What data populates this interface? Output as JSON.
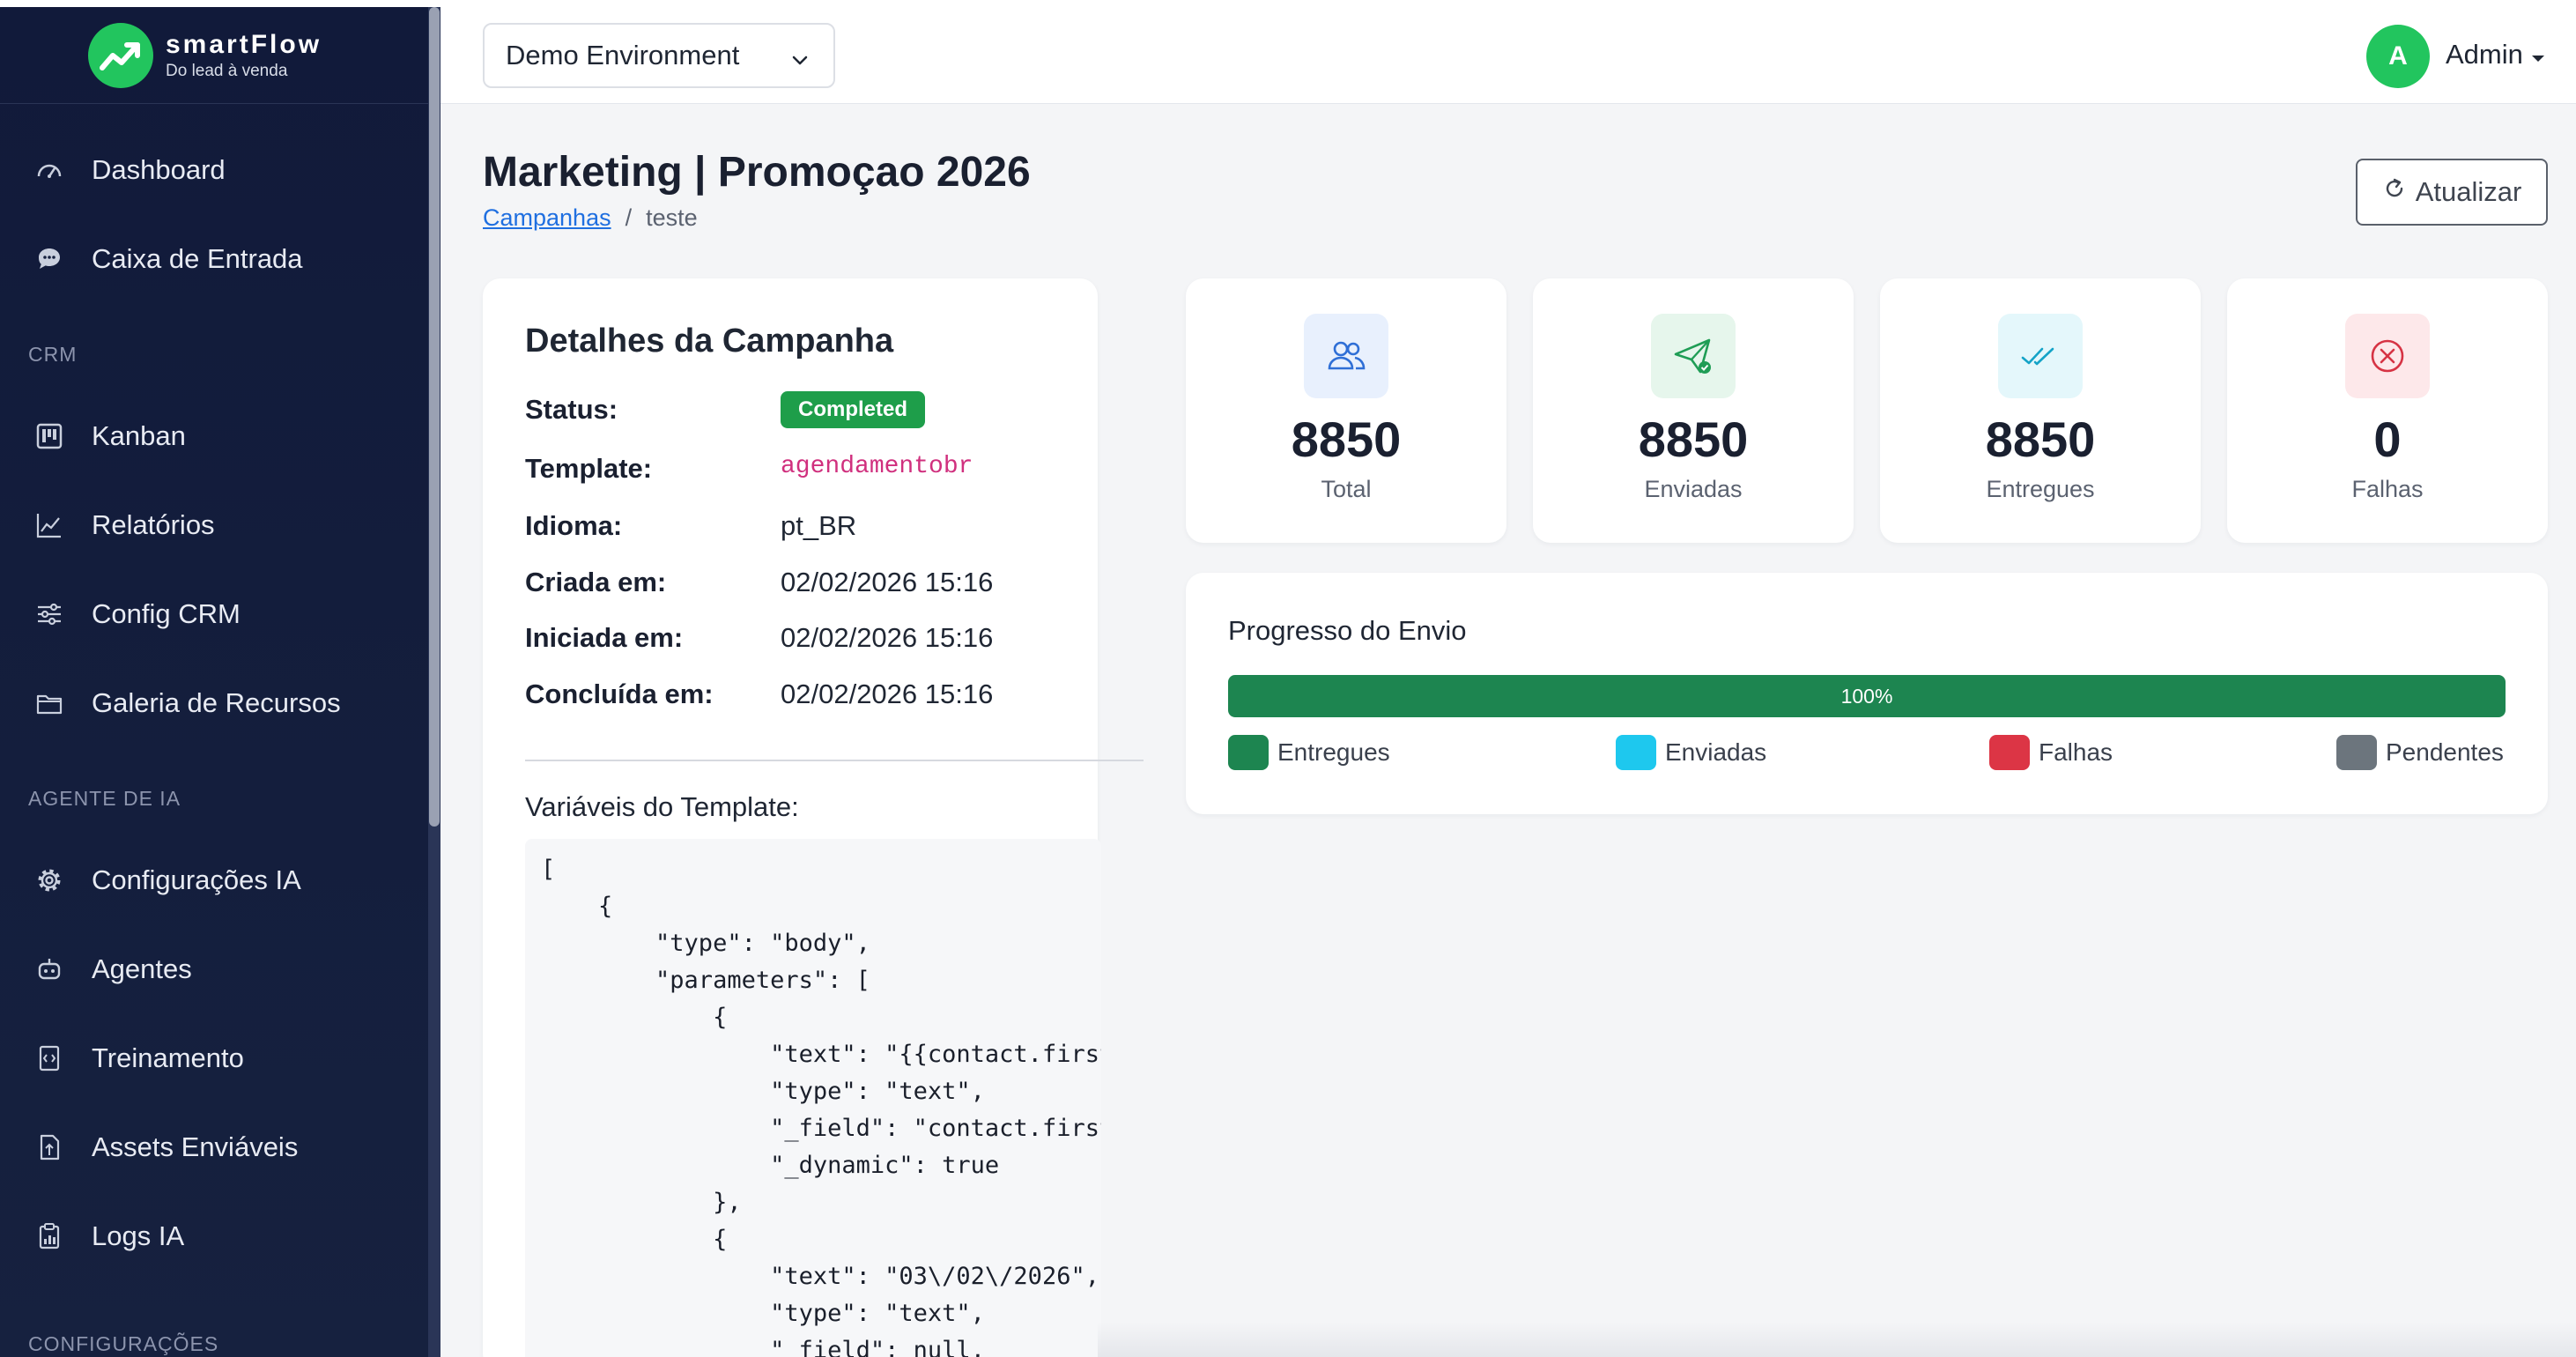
{
  "brand": {
    "name": "smartFlow",
    "tagline": "Do lead à venda"
  },
  "sidebar": {
    "items_top": [
      {
        "label": "Dashboard",
        "icon": "speedometer-icon"
      },
      {
        "label": "Caixa de Entrada",
        "icon": "chat-bubble-icon"
      }
    ],
    "section_crm": "CRM",
    "items_crm": [
      {
        "label": "Kanban",
        "icon": "kanban-icon"
      },
      {
        "label": "Relatórios",
        "icon": "line-chart-icon"
      },
      {
        "label": "Config CRM",
        "icon": "sliders-icon"
      },
      {
        "label": "Galeria de Recursos",
        "icon": "folder-icon"
      }
    ],
    "section_ai": "AGENTE DE IA",
    "items_ai": [
      {
        "label": "Configurações IA",
        "icon": "gear-icon"
      },
      {
        "label": "Agentes",
        "icon": "robot-icon"
      },
      {
        "label": "Treinamento",
        "icon": "code-file-icon"
      },
      {
        "label": "Assets Enviáveis",
        "icon": "file-upload-icon"
      },
      {
        "label": "Logs IA",
        "icon": "clipboard-icon"
      }
    ],
    "section_config": "CONFIGURAÇÕES"
  },
  "header": {
    "environment": "Demo Environment",
    "user_initial": "A",
    "user_name": "Admin"
  },
  "page": {
    "title": "Marketing | Promoçao 2026",
    "breadcrumb_link": "Campanhas",
    "breadcrumb_sep": "/",
    "breadcrumb_current": "teste",
    "refresh_label": "Atualizar"
  },
  "details": {
    "title": "Detalhes da Campanha",
    "rows": [
      {
        "label": "Status:",
        "value": "Completed"
      },
      {
        "label": "Template:",
        "value": "agendamentobr"
      },
      {
        "label": "Idioma:",
        "value": "pt_BR"
      },
      {
        "label": "Criada em:",
        "value": "02/02/2026 15:16"
      },
      {
        "label": "Iniciada em:",
        "value": "02/02/2026 15:16"
      },
      {
        "label": "Concluída em:",
        "value": "02/02/2026 15:16"
      }
    ],
    "vars_label": "Variáveis do Template:",
    "code": "[\n    {\n        \"type\": \"body\",\n        \"parameters\": [\n            {\n                \"text\": \"{{contact.first_name}}\",\n                \"type\": \"text\",\n                \"_field\": \"contact.first_name\",\n                \"_dynamic\": true\n            },\n            {\n                \"text\": \"03\\/02\\/2026\",\n                \"type\": \"text\",\n                \"_field\": null,"
  },
  "stats": [
    {
      "value": "8850",
      "label": "Total",
      "icon": "users-icon",
      "color": "#2f6fd6",
      "bg": "#e8f0fd"
    },
    {
      "value": "8850",
      "label": "Enviadas",
      "icon": "send-check-icon",
      "color": "#1f9d55",
      "bg": "#e6f6ec"
    },
    {
      "value": "8850",
      "label": "Entregues",
      "icon": "double-check-icon",
      "color": "#14a3c7",
      "bg": "#e4f7fb"
    },
    {
      "value": "0",
      "label": "Falhas",
      "icon": "x-circle-icon",
      "color": "#d63344",
      "bg": "#fde8ea"
    }
  ],
  "progress": {
    "title": "Progresso do Envio",
    "percent": 100,
    "percent_label": "100%",
    "legend": [
      {
        "label": "Entregues",
        "color": "#1d8550"
      },
      {
        "label": "Enviadas",
        "color": "#1ec8ee"
      },
      {
        "label": "Falhas",
        "color": "#dc3545"
      },
      {
        "label": "Pendentes",
        "color": "#6c757d"
      }
    ]
  }
}
